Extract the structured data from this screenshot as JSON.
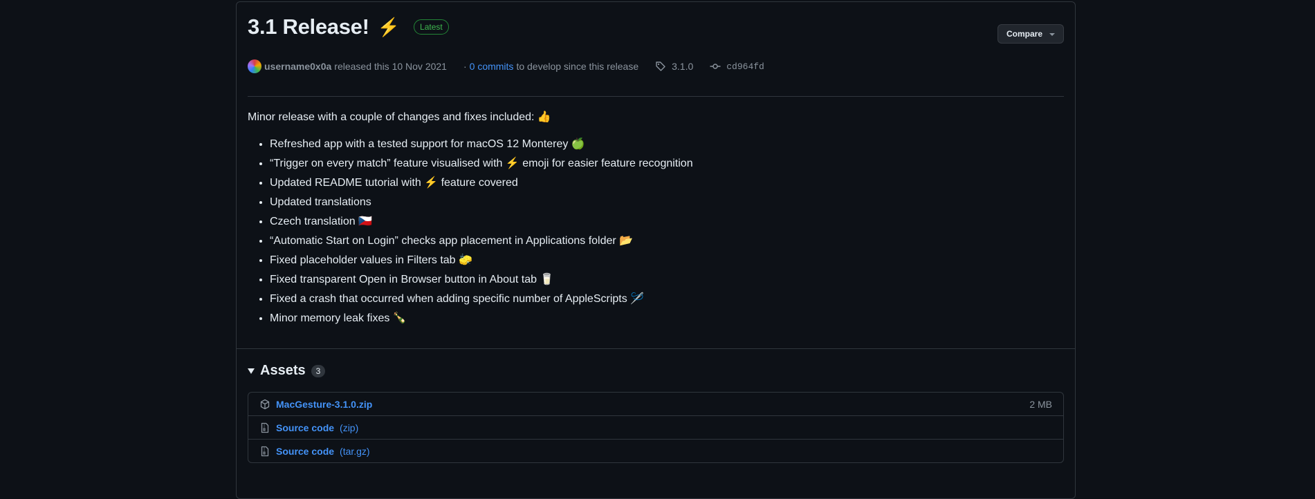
{
  "release": {
    "title": "3.1 Release!",
    "title_emoji": "⚡",
    "latest_badge": "Latest",
    "compare_label": "Compare"
  },
  "meta": {
    "author": "username0x0a",
    "released_text": "released this 10 Nov 2021",
    "commits_prefix": "·",
    "commits_link": "0 commits",
    "commits_suffix": "to develop since this release",
    "tag": "3.1.0",
    "commit_hash": "cd964fd"
  },
  "notes": {
    "intro": "Minor release with a couple of changes and fixes included: 👍",
    "items": [
      "Refreshed app with a tested support for macOS 12 Monterey 🍏",
      "“Trigger on every match” feature visualised with ⚡ emoji for easier feature recognition",
      "Updated README tutorial with ⚡ feature covered",
      "Updated translations",
      "Czech translation 🇨🇿",
      "“Automatic Start on Login” checks app placement in Applications folder 📂",
      "Fixed placeholder values in Filters tab 🧽",
      "Fixed transparent Open in Browser button in About tab 🥛",
      "Fixed a crash that occurred when adding specific number of AppleScripts 🪡",
      "Minor memory leak fixes 🍾"
    ]
  },
  "assets": {
    "title": "Assets",
    "count": "3",
    "files": [
      {
        "name": "MacGesture-3.1.0.zip",
        "ext": "",
        "size": "2 MB",
        "icon": "package-icon"
      },
      {
        "name": "Source code",
        "ext": "(zip)",
        "size": "",
        "icon": "file-zip-icon"
      },
      {
        "name": "Source code",
        "ext": "(tar.gz)",
        "size": "",
        "icon": "file-zip-icon"
      }
    ]
  },
  "colors": {
    "background": "#0d1117",
    "border": "#30363d",
    "link": "#4493f8",
    "latest_green": "#3fb950",
    "muted": "#8b949e"
  }
}
